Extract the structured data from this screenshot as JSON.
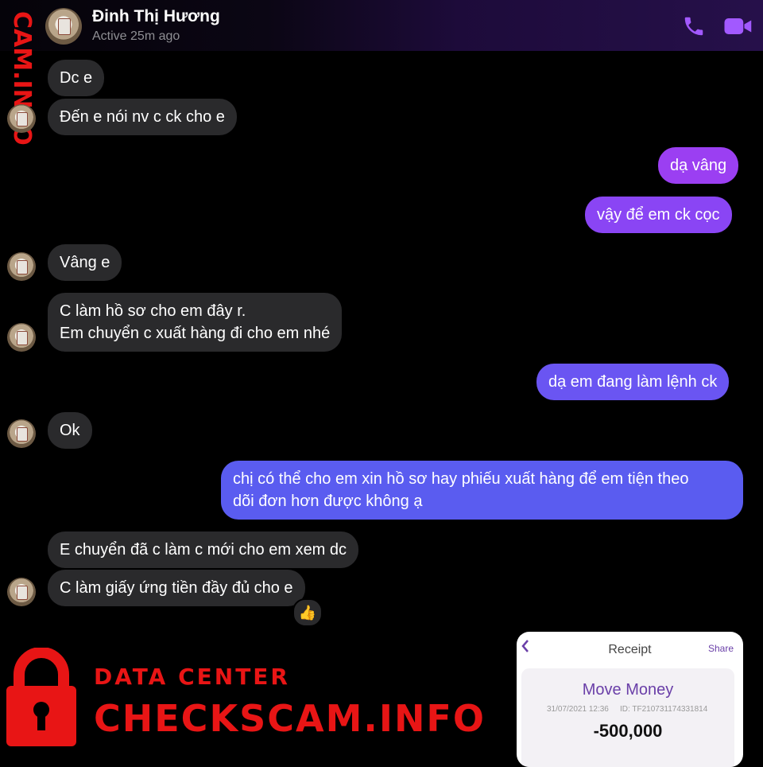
{
  "header": {
    "contact_name": "Đinh Thị Hương",
    "status": "Active 25m ago",
    "phone_icon": "phone-icon",
    "video_icon": "video-camera-icon",
    "accent_color": "#a259ff"
  },
  "messages": [
    {
      "direction": "in",
      "text": "Dc e"
    },
    {
      "direction": "in",
      "text": "Đến e nói nv c ck cho e"
    },
    {
      "direction": "out",
      "text": "dạ vâng"
    },
    {
      "direction": "out",
      "text": "vậy để em ck cọc"
    },
    {
      "direction": "in",
      "text": "Vâng e"
    },
    {
      "direction": "in",
      "text": "C làm hồ sơ cho em đây r.\nEm chuyển c xuất hàng đi cho em nhé"
    },
    {
      "direction": "out",
      "text": "dạ em đang làm lệnh ck"
    },
    {
      "direction": "in",
      "text": "Ok"
    },
    {
      "direction": "out",
      "text": "chị có thể cho em xin hồ sơ hay phiếu xuất hàng để em tiện theo\ndõi đơn hơn được không ạ"
    },
    {
      "direction": "in",
      "text": "E chuyển đã c làm c mới cho em xem dc"
    },
    {
      "direction": "in",
      "text": "C làm giấy ứng tiền đầy đủ cho e",
      "reaction": "👍"
    }
  ],
  "receipt": {
    "title": "Receipt",
    "share": "Share",
    "heading": "Move Money",
    "date": "31/07/2021 12:36",
    "id": "ID: TF210731174331814",
    "amount": "-500,000"
  },
  "watermark": {
    "side_text": "CAM.INFO",
    "label": "DATA CENTER",
    "url": "CHECKSCAM.INFO",
    "color": "#e81515"
  },
  "colors": {
    "incoming_bubble": "#2a2a2c",
    "outgoing_top": "#9b3ff2",
    "outgoing_bottom": "#5a5cf0"
  }
}
